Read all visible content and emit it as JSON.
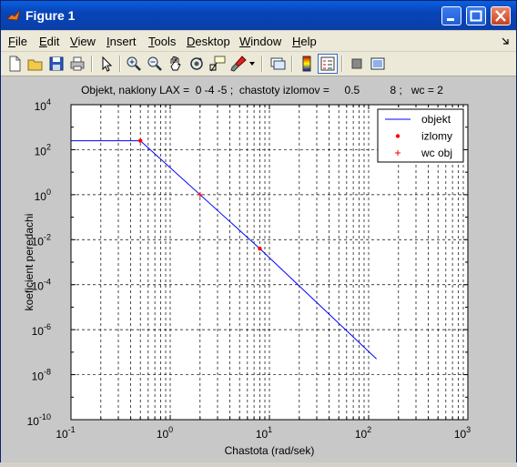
{
  "window": {
    "title": "Figure 1"
  },
  "menu": [
    {
      "label": "File"
    },
    {
      "label": "Edit"
    },
    {
      "label": "View"
    },
    {
      "label": "Insert"
    },
    {
      "label": "Tools"
    },
    {
      "label": "Desktop"
    },
    {
      "label": "Window"
    },
    {
      "label": "Help"
    }
  ],
  "toolbar": {
    "tools": [
      "new-figure-icon",
      "open-file-icon",
      "save-icon",
      "print-icon",
      "pointer-icon",
      "zoom-in-icon",
      "zoom-out-icon",
      "pan-icon",
      "rotate-icon",
      "data-cursor-icon",
      "brush-icon",
      "link-icon",
      "colorbar-icon",
      "legend-icon",
      "hide-plot-tools-icon",
      "show-plot-tools-icon"
    ]
  },
  "chart_data": {
    "type": "line",
    "title": "Objekt, naklony LAX =  0 -4 -5 ;  chastoty izlomov =     0.5          8 ;   wc = 2",
    "xlabel": "Chastota (rad/sek)",
    "ylabel": "koeficient peredachi",
    "xscale": "log",
    "yscale": "log",
    "xlim": [
      0.1,
      1000
    ],
    "ylim": [
      1e-10,
      10000
    ],
    "xticks": [
      {
        "base": "10",
        "exp": "-1"
      },
      {
        "base": "10",
        "exp": "0"
      },
      {
        "base": "10",
        "exp": "1"
      },
      {
        "base": "10",
        "exp": "2"
      },
      {
        "base": "10",
        "exp": "3"
      }
    ],
    "yticks": [
      {
        "base": "10",
        "exp": "-10"
      },
      {
        "base": "10",
        "exp": "-8"
      },
      {
        "base": "10",
        "exp": "-6"
      },
      {
        "base": "10",
        "exp": "-4"
      },
      {
        "base": "10",
        "exp": "-2"
      },
      {
        "base": "10",
        "exp": "0"
      },
      {
        "base": "10",
        "exp": "2"
      },
      {
        "base": "10",
        "exp": "4"
      }
    ],
    "grid": true,
    "legend_position": "top-right",
    "series": [
      {
        "name": "objekt",
        "color": "#0000ff",
        "marker": "line",
        "x": [
          0.1,
          0.5,
          8,
          120
        ],
        "y": [
          250,
          250,
          0.004,
          5e-08
        ]
      },
      {
        "name": "izlomy",
        "color": "#ff0000",
        "marker": "dot",
        "x": [
          0.5,
          8
        ],
        "y": [
          250,
          0.004
        ]
      },
      {
        "name": "wc obj",
        "color": "#ff0000",
        "marker": "plus",
        "x": [
          2
        ],
        "y": [
          1
        ]
      }
    ]
  }
}
